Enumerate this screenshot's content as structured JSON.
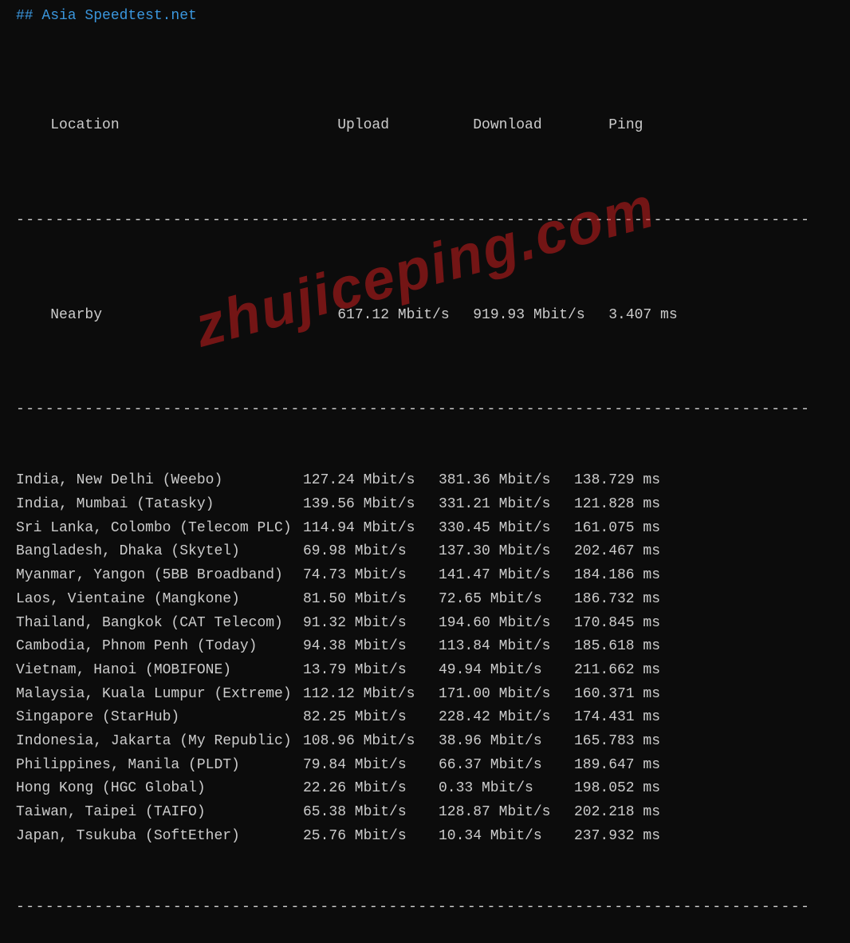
{
  "title": "## Asia Speedtest.net",
  "headers": {
    "location": "Location",
    "upload": "Upload",
    "download": "Download",
    "ping": "Ping"
  },
  "nearby": {
    "location": "Nearby",
    "upload": "617.12 Mbit/s",
    "download": "919.93 Mbit/s",
    "ping": "3.407 ms"
  },
  "rows": [
    {
      "location": "India, New Delhi (Weebo)",
      "upload": "127.24 Mbit/s",
      "download": "381.36 Mbit/s",
      "ping": "138.729 ms"
    },
    {
      "location": "India, Mumbai (Tatasky)",
      "upload": "139.56 Mbit/s",
      "download": "331.21 Mbit/s",
      "ping": "121.828 ms"
    },
    {
      "location": "Sri Lanka, Colombo (Telecom PLC)",
      "upload": "114.94 Mbit/s",
      "download": "330.45 Mbit/s",
      "ping": "161.075 ms"
    },
    {
      "location": "Bangladesh, Dhaka (Skytel)",
      "upload": "69.98 Mbit/s",
      "download": "137.30 Mbit/s",
      "ping": "202.467 ms"
    },
    {
      "location": "Myanmar, Yangon (5BB Broadband)",
      "upload": "74.73 Mbit/s",
      "download": "141.47 Mbit/s",
      "ping": "184.186 ms"
    },
    {
      "location": "Laos, Vientaine (Mangkone)",
      "upload": "81.50 Mbit/s",
      "download": "72.65 Mbit/s",
      "ping": "186.732 ms"
    },
    {
      "location": "Thailand, Bangkok (CAT Telecom)",
      "upload": "91.32 Mbit/s",
      "download": "194.60 Mbit/s",
      "ping": "170.845 ms"
    },
    {
      "location": "Cambodia, Phnom Penh (Today)",
      "upload": "94.38 Mbit/s",
      "download": "113.84 Mbit/s",
      "ping": "185.618 ms"
    },
    {
      "location": "Vietnam, Hanoi (MOBIFONE)",
      "upload": "13.79 Mbit/s",
      "download": "49.94 Mbit/s",
      "ping": "211.662 ms"
    },
    {
      "location": "Malaysia, Kuala Lumpur (Extreme)",
      "upload": "112.12 Mbit/s",
      "download": "171.00 Mbit/s",
      "ping": "160.371 ms"
    },
    {
      "location": "Singapore (StarHub)",
      "upload": "82.25 Mbit/s",
      "download": "228.42 Mbit/s",
      "ping": "174.431 ms"
    },
    {
      "location": "Indonesia, Jakarta (My Republic)",
      "upload": "108.96 Mbit/s",
      "download": "38.96 Mbit/s",
      "ping": "165.783 ms"
    },
    {
      "location": "Philippines, Manila (PLDT)",
      "upload": "79.84 Mbit/s",
      "download": "66.37 Mbit/s",
      "ping": "189.647 ms"
    },
    {
      "location": "Hong Kong (HGC Global)",
      "upload": "22.26 Mbit/s",
      "download": "0.33 Mbit/s",
      "ping": "198.052 ms"
    },
    {
      "location": "Taiwan, Taipei (TAIFO)",
      "upload": "65.38 Mbit/s",
      "download": "128.87 Mbit/s",
      "ping": "202.218 ms"
    },
    {
      "location": "Japan, Tsukuba (SoftEther)",
      "upload": "25.76 Mbit/s",
      "download": "10.34 Mbit/s",
      "ping": "237.932 ms"
    }
  ],
  "separator": "---------------------------------------------------------------------------------",
  "watermark": "zhujiceping.com"
}
